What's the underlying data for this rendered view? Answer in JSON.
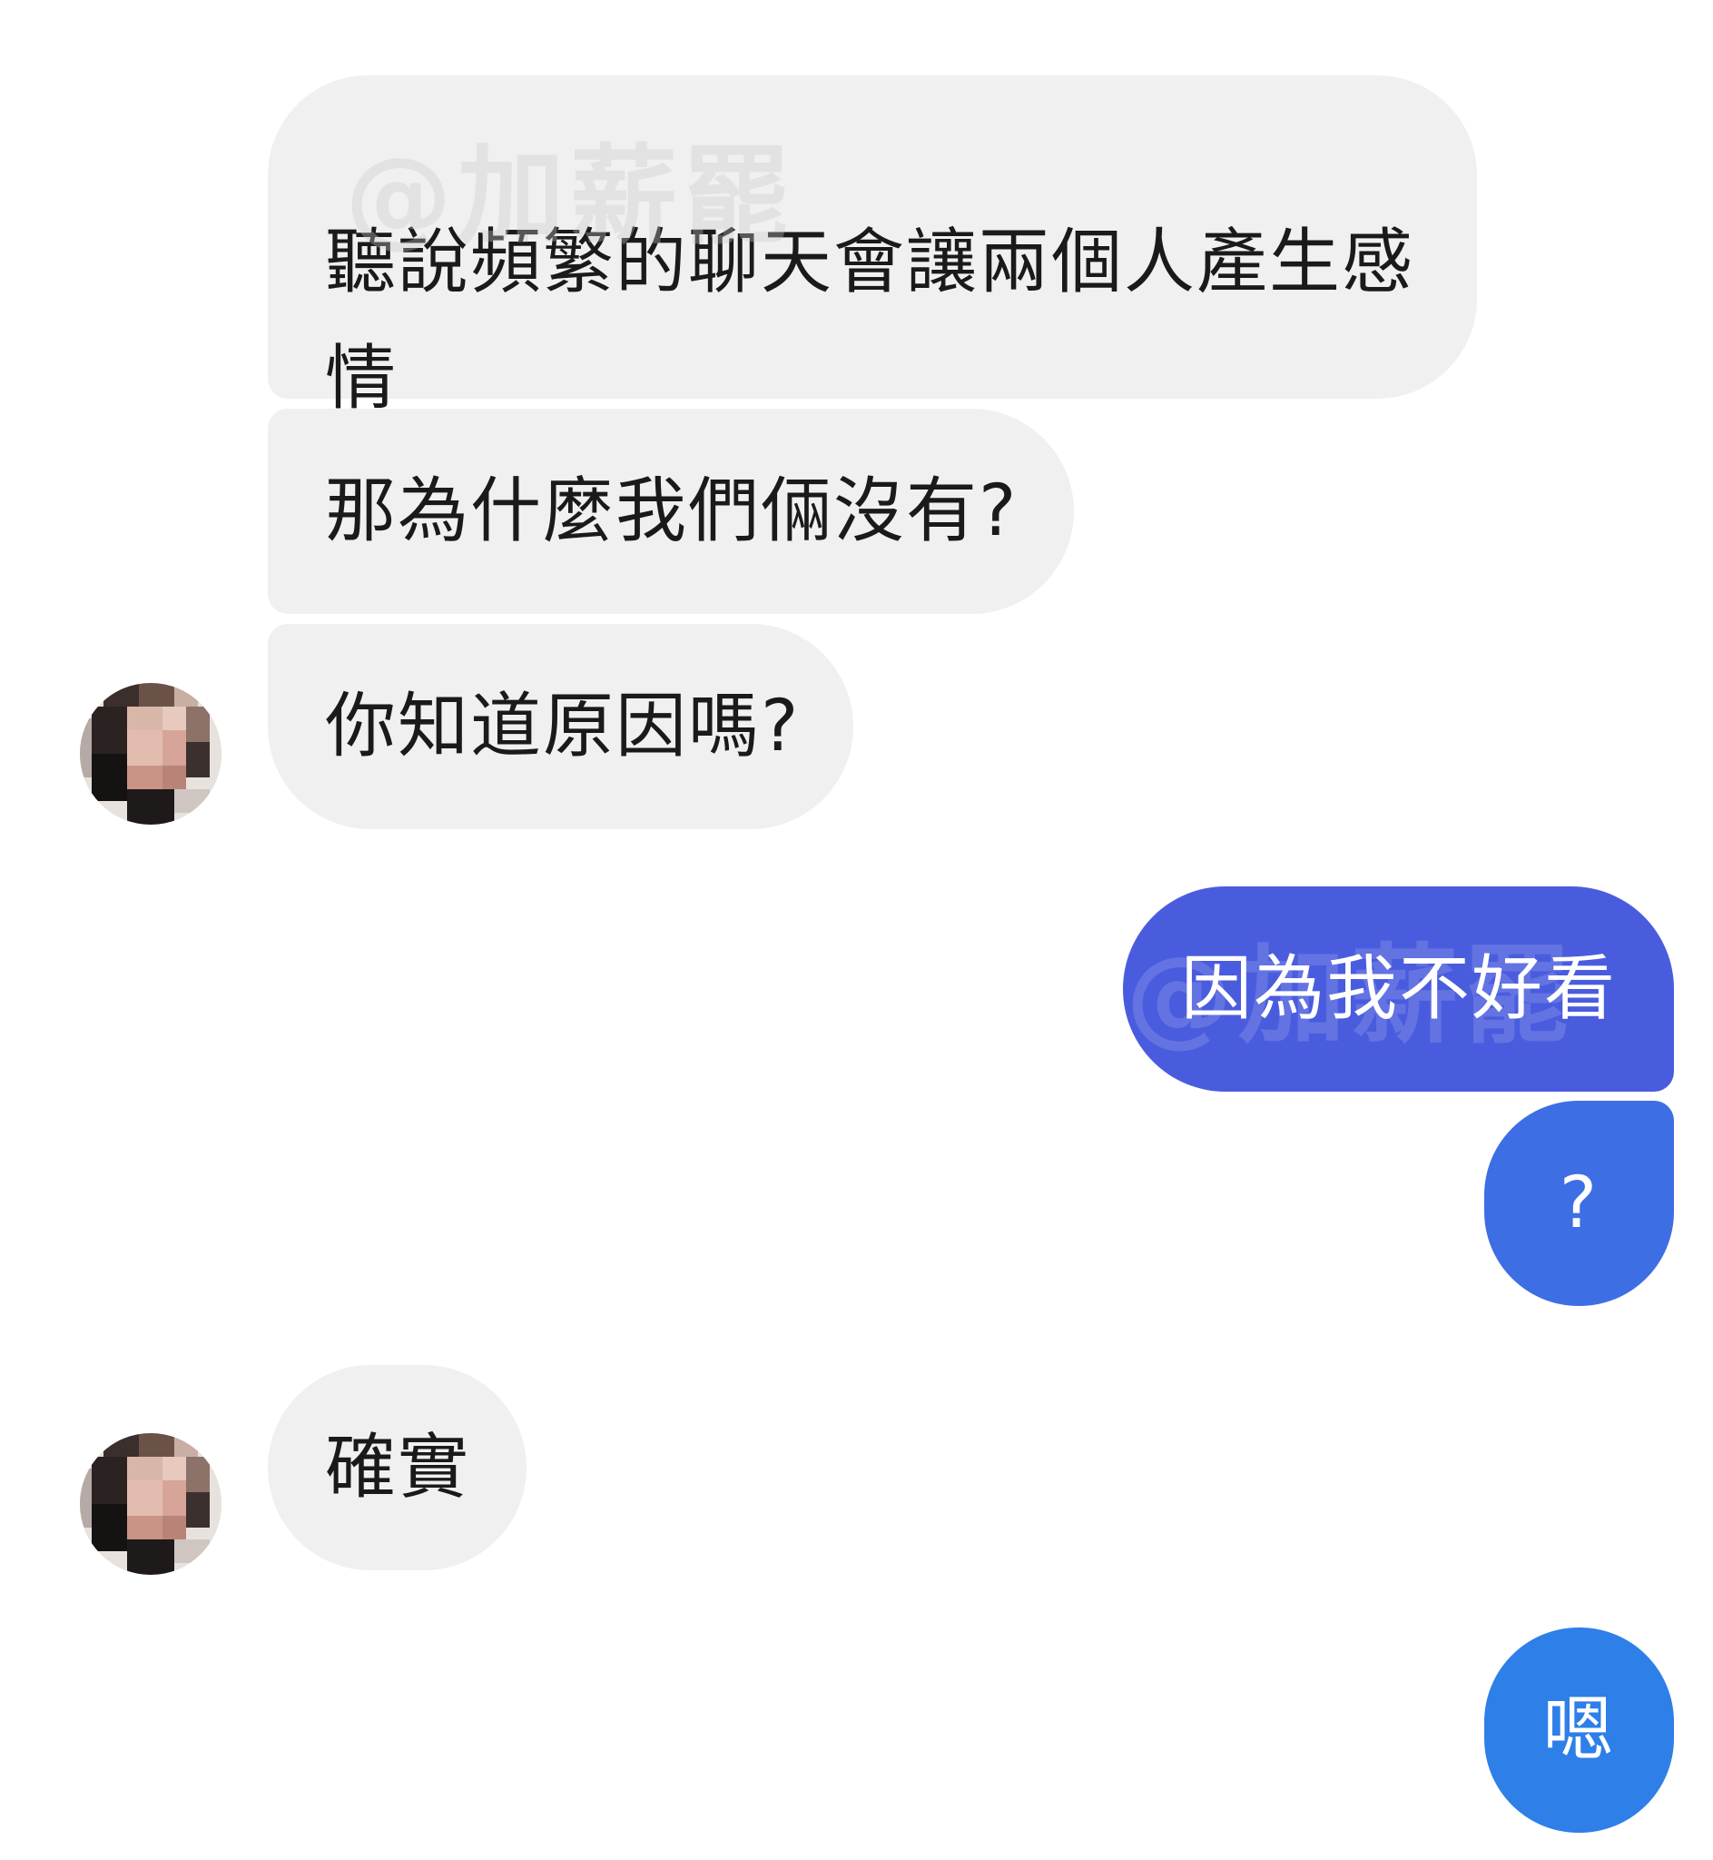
{
  "messages": [
    {
      "side": "incoming",
      "text": "聽說頻繁的聊天會讓兩個人產生感情"
    },
    {
      "side": "incoming",
      "text": "那為什麼我們倆沒有?"
    },
    {
      "side": "incoming",
      "text": "你知道原因嗎?"
    },
    {
      "side": "outgoing",
      "text": "因為我不好看"
    },
    {
      "side": "outgoing",
      "text": "?"
    },
    {
      "side": "incoming",
      "text": "確實"
    },
    {
      "side": "outgoing",
      "text": "嗯"
    }
  ],
  "watermark": "@加薪罷",
  "colors": {
    "incoming_bubble": "#f0f0f0",
    "outgoing_bubble_1": "#4a5cde",
    "outgoing_bubble_2": "#3e6ee4",
    "outgoing_bubble_3": "#2e7fe8"
  },
  "icons": {
    "contact_avatar": "avatar-icon"
  }
}
